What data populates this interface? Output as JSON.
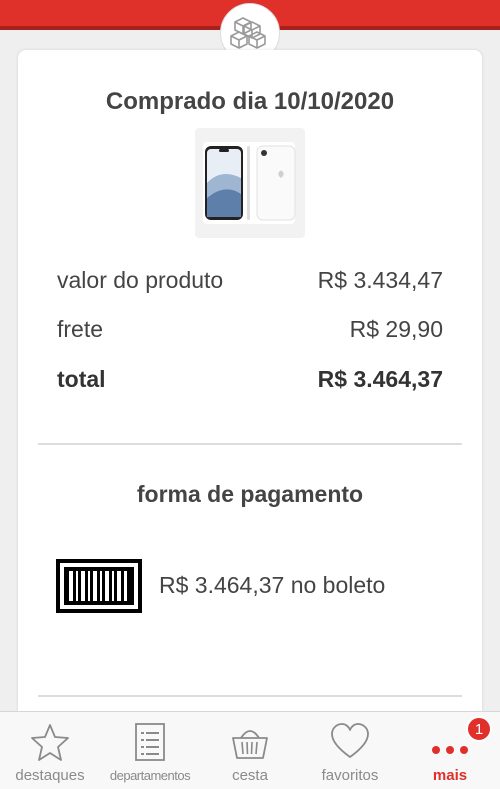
{
  "header": {
    "logo_icon": "boxes-icon",
    "accent_color": "#e0302a"
  },
  "order": {
    "purchase_title": "Comprado dia 10/10/2020",
    "product_image": "iphone-product-image",
    "summary": [
      {
        "label": "valor do produto",
        "value": "R$ 3.434,47"
      },
      {
        "label": "frete",
        "value": "R$ 29,90"
      },
      {
        "label": "total",
        "value": "R$ 3.464,37"
      }
    ]
  },
  "payment": {
    "section_title": "forma de pagamento",
    "method_icon": "barcode-icon",
    "description": "R$ 3.464,37 no boleto"
  },
  "bottom_nav": {
    "items": [
      {
        "label": "destaques",
        "icon": "star-icon"
      },
      {
        "label": "departamentos",
        "icon": "list-icon"
      },
      {
        "label": "cesta",
        "icon": "basket-icon"
      },
      {
        "label": "favoritos",
        "icon": "heart-icon"
      },
      {
        "label": "mais",
        "icon": "more-icon",
        "active": true
      }
    ],
    "badge_count": "1"
  }
}
